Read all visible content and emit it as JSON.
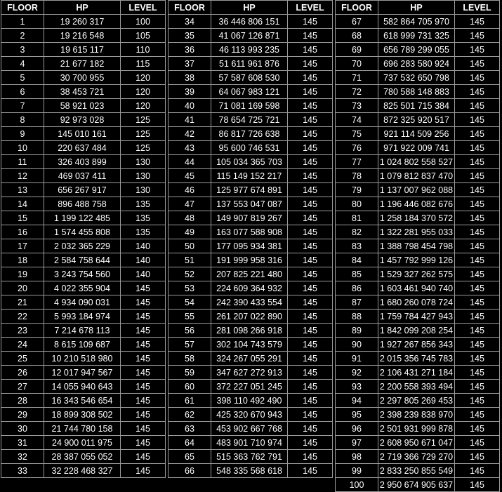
{
  "headers": {
    "floor": "FLOOR",
    "hp": "HP",
    "level": "LEVEL"
  },
  "blocks": [
    [
      [
        "1",
        "19 260 317",
        "100"
      ],
      [
        "2",
        "19 216 548",
        "105"
      ],
      [
        "3",
        "19 615 117",
        "110"
      ],
      [
        "4",
        "21 677 182",
        "115"
      ],
      [
        "5",
        "30 700 955",
        "120"
      ],
      [
        "6",
        "38 453 721",
        "120"
      ],
      [
        "7",
        "58 921 023",
        "120"
      ],
      [
        "8",
        "92 973 028",
        "125"
      ],
      [
        "9",
        "145 010 161",
        "125"
      ],
      [
        "10",
        "220 637 484",
        "125"
      ],
      [
        "11",
        "326 403 899",
        "130"
      ],
      [
        "12",
        "469 037 411",
        "130"
      ],
      [
        "13",
        "656 267 917",
        "130"
      ],
      [
        "14",
        "896 488 758",
        "135"
      ],
      [
        "15",
        "1 199 122 485",
        "135"
      ],
      [
        "16",
        "1 574 455 808",
        "135"
      ],
      [
        "17",
        "2 032 365 229",
        "140"
      ],
      [
        "18",
        "2 584 758 644",
        "140"
      ],
      [
        "19",
        "3 243 754 560",
        "140"
      ],
      [
        "20",
        "4 022 355 904",
        "145"
      ],
      [
        "21",
        "4 934 090 031",
        "145"
      ],
      [
        "22",
        "5 993 184 974",
        "145"
      ],
      [
        "23",
        "7 214 678 113",
        "145"
      ],
      [
        "24",
        "8 615 109 687",
        "145"
      ],
      [
        "25",
        "10 210 518 980",
        "145"
      ],
      [
        "26",
        "12 017 947 567",
        "145"
      ],
      [
        "27",
        "14 055 940 643",
        "145"
      ],
      [
        "28",
        "16 343 546 654",
        "145"
      ],
      [
        "29",
        "18 899 308 502",
        "145"
      ],
      [
        "30",
        "21 744 780 158",
        "145"
      ],
      [
        "31",
        "24 900 011 975",
        "145"
      ],
      [
        "32",
        "28 387 055 052",
        "145"
      ],
      [
        "33",
        "32 228 468 327",
        "145"
      ]
    ],
    [
      [
        "34",
        "36 446 806 151",
        "145"
      ],
      [
        "35",
        "41 067 126 871",
        "145"
      ],
      [
        "36",
        "46 113 993 235",
        "145"
      ],
      [
        "37",
        "51 611 961 876",
        "145"
      ],
      [
        "38",
        "57 587 608 530",
        "145"
      ],
      [
        "39",
        "64 067 983 121",
        "145"
      ],
      [
        "40",
        "71 081 169 598",
        "145"
      ],
      [
        "41",
        "78 654 725 721",
        "145"
      ],
      [
        "42",
        "86 817 726 638",
        "145"
      ],
      [
        "43",
        "95 600 746 531",
        "145"
      ],
      [
        "44",
        "105 034 365 703",
        "145"
      ],
      [
        "45",
        "115 149 152 217",
        "145"
      ],
      [
        "46",
        "125 977 674 891",
        "145"
      ],
      [
        "47",
        "137 553 047 087",
        "145"
      ],
      [
        "48",
        "149 907 819 267",
        "145"
      ],
      [
        "49",
        "163 077 588 908",
        "145"
      ],
      [
        "50",
        "177 095 934 381",
        "145"
      ],
      [
        "51",
        "191 999 958 316",
        "145"
      ],
      [
        "52",
        "207 825 221 480",
        "145"
      ],
      [
        "53",
        "224 609 364 932",
        "145"
      ],
      [
        "54",
        "242 390 433 554",
        "145"
      ],
      [
        "55",
        "261 207 022 890",
        "145"
      ],
      [
        "56",
        "281 098 266 918",
        "145"
      ],
      [
        "57",
        "302 104 743 579",
        "145"
      ],
      [
        "58",
        "324 267 055 291",
        "145"
      ],
      [
        "59",
        "347 627 272 913",
        "145"
      ],
      [
        "60",
        "372 227 051 245",
        "145"
      ],
      [
        "61",
        "398 110 492 490",
        "145"
      ],
      [
        "62",
        "425 320 670 943",
        "145"
      ],
      [
        "63",
        "453 902 667 768",
        "145"
      ],
      [
        "64",
        "483 901 710 974",
        "145"
      ],
      [
        "65",
        "515 363 762 791",
        "145"
      ],
      [
        "66",
        "548 335 568 618",
        "145"
      ]
    ],
    [
      [
        "67",
        "582 864 705 970",
        "145"
      ],
      [
        "68",
        "618 999 731 325",
        "145"
      ],
      [
        "69",
        "656 789 299 055",
        "145"
      ],
      [
        "70",
        "696 283 580 924",
        "145"
      ],
      [
        "71",
        "737 532 650 798",
        "145"
      ],
      [
        "72",
        "780 588 148 883",
        "145"
      ],
      [
        "73",
        "825 501 715 384",
        "145"
      ],
      [
        "74",
        "872 325 920 517",
        "145"
      ],
      [
        "75",
        "921 114 509 256",
        "145"
      ],
      [
        "76",
        "971 922 009 741",
        "145"
      ],
      [
        "77",
        "1 024 802 558 527",
        "145"
      ],
      [
        "78",
        "1 079 812 837 470",
        "145"
      ],
      [
        "79",
        "1 137 007 962 088",
        "145"
      ],
      [
        "80",
        "1 196 446 082 676",
        "145"
      ],
      [
        "81",
        "1 258 184 370 572",
        "145"
      ],
      [
        "82",
        "1 322 281 955 033",
        "145"
      ],
      [
        "83",
        "1 388 798 454 798",
        "145"
      ],
      [
        "84",
        "1 457 792 999 126",
        "145"
      ],
      [
        "85",
        "1 529 327 262 575",
        "145"
      ],
      [
        "86",
        "1 603 461 940 740",
        "145"
      ],
      [
        "87",
        "1 680 260 078 724",
        "145"
      ],
      [
        "88",
        "1 759 784 427 943",
        "145"
      ],
      [
        "89",
        "1 842 099 208 254",
        "145"
      ],
      [
        "90",
        "1 927 267 856 343",
        "145"
      ],
      [
        "91",
        "2 015 356 745 783",
        "145"
      ],
      [
        "92",
        "2 106 431 271 184",
        "145"
      ],
      [
        "93",
        "2 200 558 393 494",
        "145"
      ],
      [
        "94",
        "2 297 805 269 453",
        "145"
      ],
      [
        "95",
        "2 398 239 838 970",
        "145"
      ],
      [
        "96",
        "2 501 931 999 878",
        "145"
      ],
      [
        "97",
        "2 608 950 671 047",
        "145"
      ],
      [
        "98",
        "2 719 366 729 270",
        "145"
      ],
      [
        "99",
        "2 833 250 855 549",
        "145"
      ],
      [
        "100",
        "2 950 674 905 637",
        "145"
      ]
    ]
  ]
}
